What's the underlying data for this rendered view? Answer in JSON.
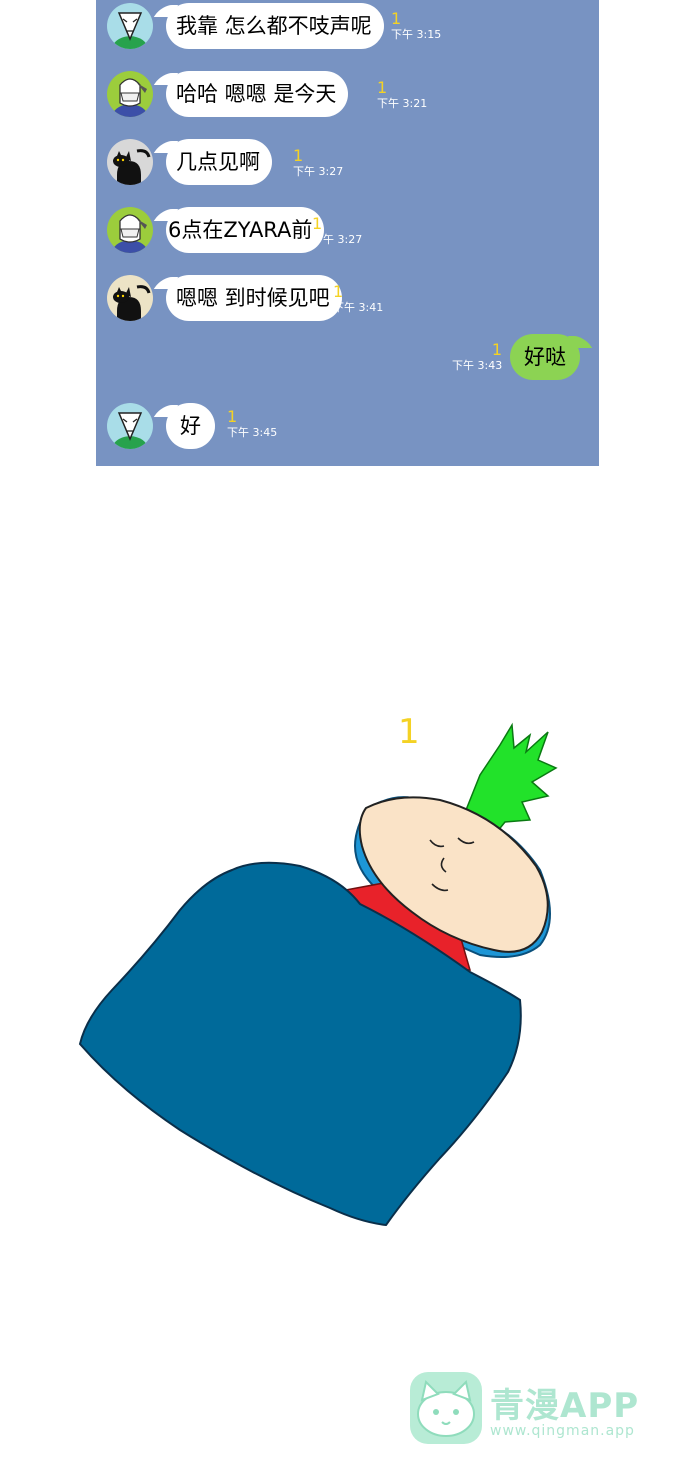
{
  "messages": [
    {
      "side": "left",
      "avatar": "guy-avatar",
      "text": "我靠 怎么都不吱声呢",
      "unread": "1",
      "time": "下午 3:15"
    },
    {
      "side": "left",
      "avatar": "masked-avatar",
      "text": "哈哈 嗯嗯 是今天",
      "unread": "1",
      "time": "下午 3:21"
    },
    {
      "side": "left",
      "avatar": "cat-avatar",
      "text": "几点见啊",
      "unread": "1",
      "time": "下午 3:27"
    },
    {
      "side": "left",
      "avatar": "masked-avatar",
      "text": "6点在ZYARA前",
      "unread": "1",
      "time": "下午 3:27"
    },
    {
      "side": "left",
      "avatar": "cat-avatar",
      "text": "嗯嗯 到时候见吧",
      "unread": "1",
      "time": "下午 3:41"
    },
    {
      "side": "right",
      "text": "好哒",
      "unread": "1",
      "time": "下午 3:43"
    },
    {
      "side": "left",
      "avatar": "guy-avatar",
      "text": "好",
      "unread": "1",
      "time": "下午 3:45"
    }
  ],
  "scene": {
    "unread_marker": "1"
  },
  "watermark": {
    "name": "青漫APP",
    "url": "www.qingman.app"
  },
  "colors": {
    "chat_bg": "#7893c2",
    "my_bubble": "#8cd353",
    "unread": "#f4d224",
    "blanket": "#006a9a"
  }
}
